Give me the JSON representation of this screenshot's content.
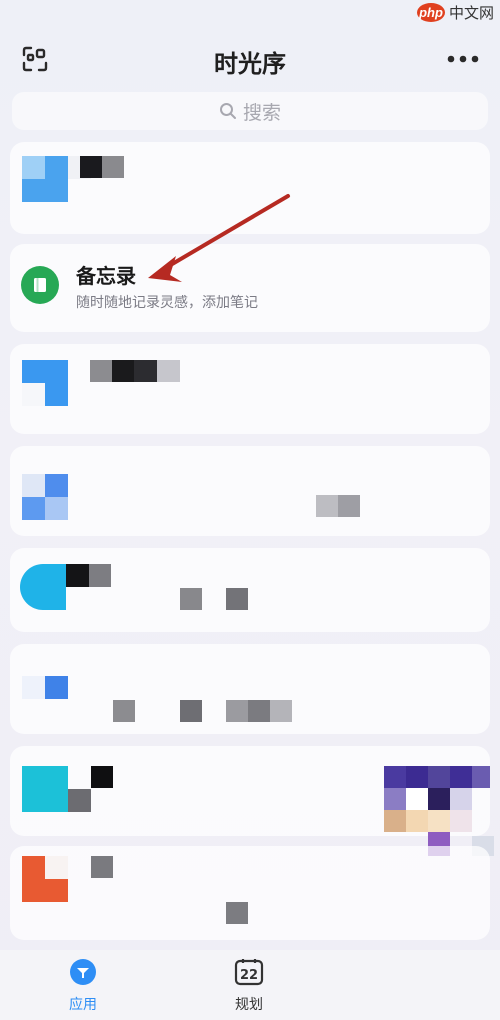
{
  "watermark": {
    "logo_text": "php",
    "site_text": "中文网"
  },
  "header": {
    "title": "时光序",
    "scan_icon": "scan-icon",
    "more_icon": "more-dots-icon"
  },
  "search": {
    "placeholder": "搜索",
    "icon": "search-icon"
  },
  "memo": {
    "title": "备忘录",
    "description": "随时随地记录灵感，添加笔记",
    "icon": "notebook-icon"
  },
  "tabbar": {
    "tabs": [
      {
        "label": "应用",
        "icon": "apps-icon",
        "active": true
      },
      {
        "label": "规划",
        "icon": "calendar-icon",
        "badge": "22",
        "active": false
      }
    ]
  },
  "colors": {
    "accent": "#2e8ef5",
    "memo_green": "#27a855",
    "arrow_red": "#b62a22"
  }
}
